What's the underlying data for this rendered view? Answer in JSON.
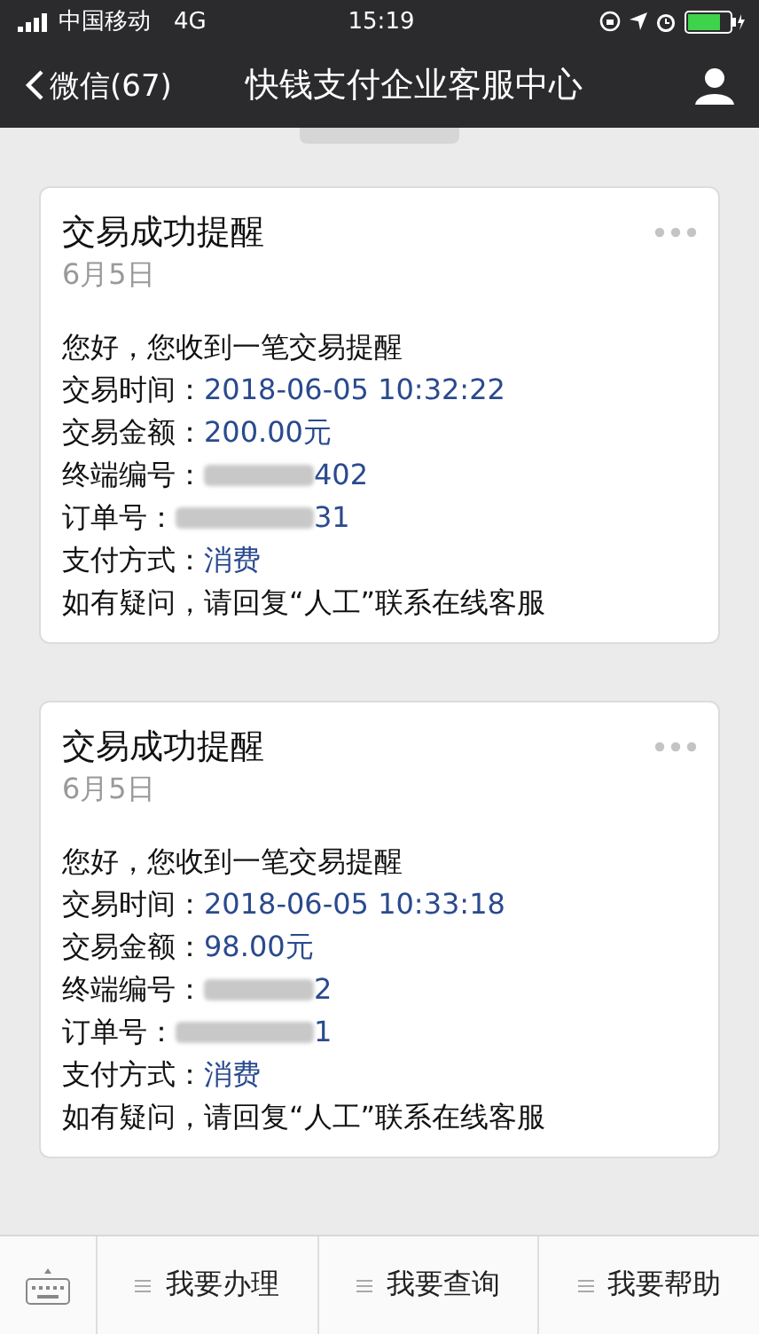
{
  "status_bar": {
    "carrier": "中国移动",
    "network": "4G",
    "time": "15:19"
  },
  "nav_bar": {
    "back_label": "微信(67)",
    "title": "快钱支付企业客服中心"
  },
  "messages": [
    {
      "title": "交易成功提醒",
      "date": "6月5日",
      "greeting": "您好，您收到一笔交易提醒",
      "fields": [
        {
          "label": "交易时间：",
          "value": "2018-06-05 10:32:22",
          "kind": "plain"
        },
        {
          "label": "交易金额：",
          "value": "200.00元",
          "kind": "plain"
        },
        {
          "label": "终端编号：",
          "value": "402",
          "kind": "redacted"
        },
        {
          "label": "订单号：",
          "value": "31",
          "kind": "redacted"
        },
        {
          "label": "支付方式：",
          "value": "消费",
          "kind": "plain"
        }
      ],
      "footer": "如有疑问，请回复“人工”联系在线客服"
    },
    {
      "title": "交易成功提醒",
      "date": "6月5日",
      "greeting": "您好，您收到一笔交易提醒",
      "fields": [
        {
          "label": "交易时间：",
          "value": "2018-06-05 10:33:18",
          "kind": "plain"
        },
        {
          "label": "交易金额：",
          "value": "98.00元",
          "kind": "plain"
        },
        {
          "label": "终端编号：",
          "value": "2",
          "kind": "redacted"
        },
        {
          "label": "订单号：",
          "value": "1",
          "kind": "redacted"
        },
        {
          "label": "支付方式：",
          "value": "消费",
          "kind": "plain"
        }
      ],
      "footer": "如有疑问，请回复“人工”联系在线客服"
    }
  ],
  "menu": [
    {
      "label": "我要办理"
    },
    {
      "label": "我要查询"
    },
    {
      "label": "我要帮助"
    }
  ]
}
